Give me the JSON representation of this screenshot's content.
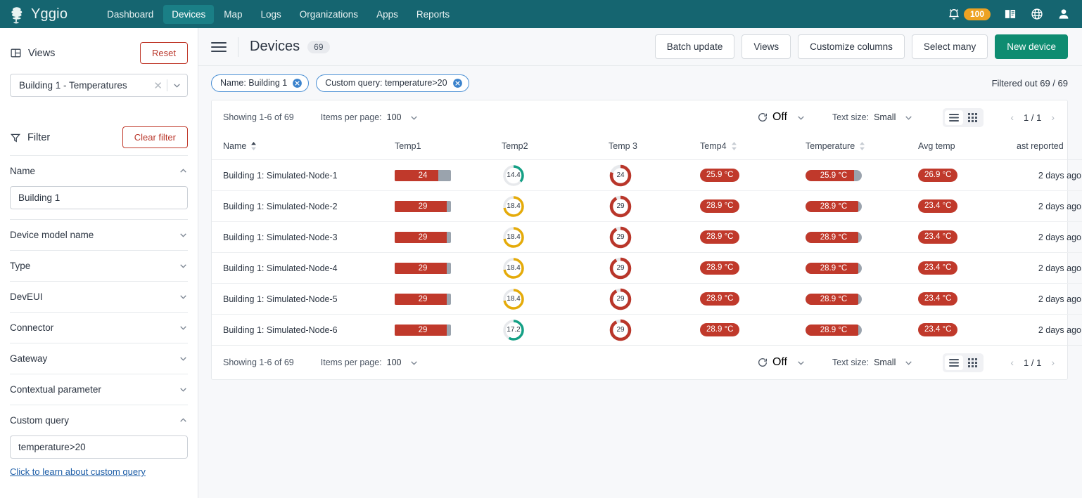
{
  "topnav": {
    "brand": "Yggio",
    "links": [
      {
        "label": "Dashboard",
        "active": false
      },
      {
        "label": "Devices",
        "active": true
      },
      {
        "label": "Map",
        "active": false
      },
      {
        "label": "Logs",
        "active": false
      },
      {
        "label": "Organizations",
        "active": false
      },
      {
        "label": "Apps",
        "active": false
      },
      {
        "label": "Reports",
        "active": false
      }
    ],
    "notification_count": "100",
    "accent": "#156570",
    "active_bg": "#1a7f86",
    "badge_color": "#eda223"
  },
  "sidebar": {
    "views": {
      "title": "Views",
      "reset_label": "Reset",
      "selected": "Building 1 - Temperatures"
    },
    "filter": {
      "title": "Filter",
      "clear_label": "Clear filter",
      "name_label": "Name",
      "name_value": "Building 1",
      "sections": [
        {
          "label": "Device model name",
          "expanded": false
        },
        {
          "label": "Type",
          "expanded": false
        },
        {
          "label": "DevEUI",
          "expanded": false
        },
        {
          "label": "Connector",
          "expanded": false
        },
        {
          "label": "Gateway",
          "expanded": false
        },
        {
          "label": "Contextual parameter",
          "expanded": false
        }
      ],
      "custom_query_label": "Custom query",
      "custom_query_value": "temperature>20",
      "learn_link": "Click to learn about custom query"
    }
  },
  "main": {
    "page_title": "Devices",
    "device_count": "69",
    "buttons": {
      "batch_update": "Batch update",
      "views": "Views",
      "customize_columns": "Customize columns",
      "select_many": "Select many",
      "new_device": "New device"
    },
    "chips": [
      {
        "label": "Name: Building 1"
      },
      {
        "label": "Custom query: temperature>20"
      }
    ],
    "filtered_out": "Filtered out 69 / 69"
  },
  "toolbar": {
    "showing": "Showing 1-6 of 69",
    "items_per_page_label": "Items per page:",
    "items_per_page_value": "100",
    "refresh_value": "Off",
    "text_size_label": "Text size:",
    "text_size_value": "Small",
    "page_indicator": "1 / 1"
  },
  "table": {
    "columns": [
      {
        "label": "Name",
        "sortable": true,
        "align": "left"
      },
      {
        "label": "Temp1",
        "sortable": false,
        "align": "left"
      },
      {
        "label": "Temp2",
        "sortable": false,
        "align": "left"
      },
      {
        "label": "Temp 3",
        "sortable": false,
        "align": "left"
      },
      {
        "label": "Temp4",
        "sortable": true,
        "align": "left"
      },
      {
        "label": "Temperature",
        "sortable": true,
        "align": "left"
      },
      {
        "label": "Avg temp",
        "sortable": false,
        "align": "left"
      },
      {
        "label": "ast reported",
        "sortable": false,
        "align": "right"
      }
    ],
    "rows": [
      {
        "name": "Building 1: Simulated-Node-1",
        "temp1": {
          "value": "24",
          "fill_pct": 78
        },
        "temp2": {
          "value": "14.4",
          "arc_pct": 36,
          "color": "#14a085"
        },
        "temp3": {
          "value": "24",
          "arc_pct": 80,
          "color": "#b9362a"
        },
        "temp4": "25.9 °C",
        "temperature": {
          "value": "25.9 °C",
          "fill_pct": 86
        },
        "avg_temp": "26.9 °C",
        "last_reported": "2 days ago"
      },
      {
        "name": "Building 1: Simulated-Node-2",
        "temp1": {
          "value": "29",
          "fill_pct": 93
        },
        "temp2": {
          "value": "18.4",
          "arc_pct": 72,
          "color": "#e5ab09"
        },
        "temp3": {
          "value": "29",
          "arc_pct": 92,
          "color": "#b9362a"
        },
        "temp4": "28.9 °C",
        "temperature": {
          "value": "28.9 °C",
          "fill_pct": 94
        },
        "avg_temp": "23.4 °C",
        "last_reported": "2 days ago"
      },
      {
        "name": "Building 1: Simulated-Node-3",
        "temp1": {
          "value": "29",
          "fill_pct": 93
        },
        "temp2": {
          "value": "18.4",
          "arc_pct": 72,
          "color": "#e5ab09"
        },
        "temp3": {
          "value": "29",
          "arc_pct": 92,
          "color": "#b9362a"
        },
        "temp4": "28.9 °C",
        "temperature": {
          "value": "28.9 °C",
          "fill_pct": 94
        },
        "avg_temp": "23.4 °C",
        "last_reported": "2 days ago"
      },
      {
        "name": "Building 1: Simulated-Node-4",
        "temp1": {
          "value": "29",
          "fill_pct": 93
        },
        "temp2": {
          "value": "18.4",
          "arc_pct": 72,
          "color": "#e5ab09"
        },
        "temp3": {
          "value": "29",
          "arc_pct": 92,
          "color": "#b9362a"
        },
        "temp4": "28.9 °C",
        "temperature": {
          "value": "28.9 °C",
          "fill_pct": 94
        },
        "avg_temp": "23.4 °C",
        "last_reported": "2 days ago"
      },
      {
        "name": "Building 1: Simulated-Node-5",
        "temp1": {
          "value": "29",
          "fill_pct": 93
        },
        "temp2": {
          "value": "18.4",
          "arc_pct": 72,
          "color": "#e5ab09"
        },
        "temp3": {
          "value": "29",
          "arc_pct": 92,
          "color": "#b9362a"
        },
        "temp4": "28.9 °C",
        "temperature": {
          "value": "28.9 °C",
          "fill_pct": 94
        },
        "avg_temp": "23.4 °C",
        "last_reported": "2 days ago"
      },
      {
        "name": "Building 1: Simulated-Node-6",
        "temp1": {
          "value": "29",
          "fill_pct": 93
        },
        "temp2": {
          "value": "17.2",
          "arc_pct": 58,
          "color": "#14a085"
        },
        "temp3": {
          "value": "29",
          "arc_pct": 92,
          "color": "#b9362a"
        },
        "temp4": "28.9 °C",
        "temperature": {
          "value": "28.9 °C",
          "fill_pct": 94
        },
        "avg_temp": "23.4 °C",
        "last_reported": "2 days ago"
      }
    ]
  },
  "colors": {
    "red": "#c0392b",
    "gray_track": "#9aa3ad",
    "green": "#0e8c71"
  }
}
